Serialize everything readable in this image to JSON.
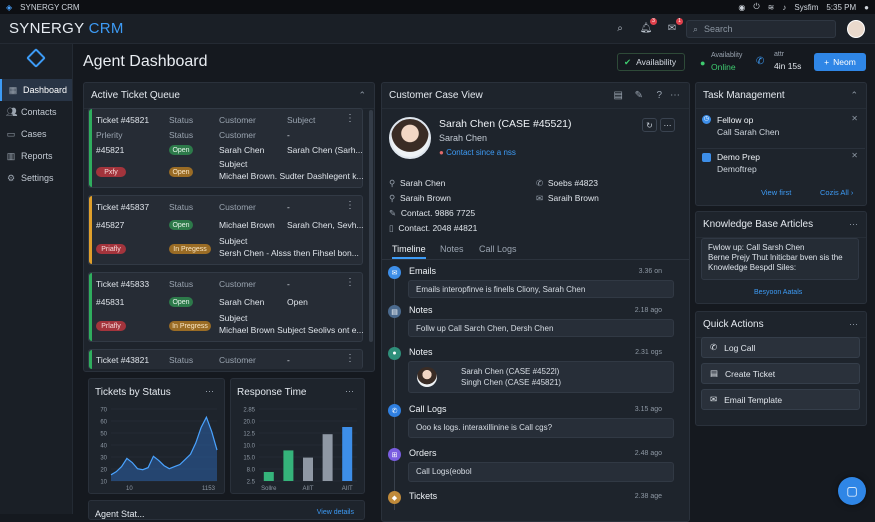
{
  "system_bar": {
    "app": "SYNERGY CRM",
    "user": "Sysfim",
    "time": "5:35 PM"
  },
  "header": {
    "brand_main": "SYNERGY",
    "brand_sub": "CRM",
    "search_placeholder": "Search",
    "notif_count": "3",
    "mail_count": "1"
  },
  "sidebar": {
    "items": [
      {
        "label": "Dashboard",
        "icon": "grid-icon"
      },
      {
        "label": "Contacts",
        "icon": "people-icon"
      },
      {
        "label": "Cases",
        "icon": "folder-icon"
      },
      {
        "label": "Reports",
        "icon": "chart-icon"
      },
      {
        "label": "Settings",
        "icon": "gear-icon"
      }
    ]
  },
  "page": {
    "title": "Agent Dashboard"
  },
  "status": {
    "availability": "Availability",
    "agent_label": "Availablity",
    "agent_status": "Online",
    "call_label": "attr",
    "call_time": "4in 15s",
    "new_button": "Neom"
  },
  "queue": {
    "title": "Active Ticket Queue",
    "tickets": [
      {
        "id": "Ticket #45821",
        "priority_label": "Prlerity",
        "num": "#45821",
        "status": "Status",
        "status_sub": "Status",
        "status_badge": "Open",
        "status2": "Open",
        "customer_hdr": "Customer",
        "customer_sub": "Customer",
        "customer": "Sarah Chen",
        "subject_hdr": "Subject",
        "subject_dash": "-",
        "subject": "Sarah Chen (Sarh...",
        "subj_label": "Subject",
        "subj_line": "Michael Brown. Sudter Dashlegent k...",
        "priority_badge": "Pxfy"
      },
      {
        "id": "Ticket #45837",
        "num": "#45827",
        "status": "Status",
        "status_badge": "Open",
        "status2": "In Pregess",
        "customer_hdr": "Customer",
        "customer": "Michael Brown",
        "subject_dash": "-",
        "subject": "Sarah Chen, Sevh...",
        "subj_label": "Subject",
        "subj_line": "Sersh Chen - Alsss then Fihsel bon...",
        "priority_badge": "Priafly"
      },
      {
        "id": "Ticket #45833",
        "num": "#45831",
        "status": "Status",
        "status_badge": "Open",
        "status2": "In Pregress",
        "customer_hdr": "Customer",
        "customer": "Sarah Chen",
        "subject_dash": "-",
        "subject": "Open",
        "subj_label": "Subject",
        "subj_line": "Michael Brown Subject Seolivs ont e...",
        "priority_badge": "Prlafly"
      },
      {
        "id": "Ticket #43821",
        "status": "Status",
        "customer_hdr": "Customer",
        "subject_dash": "-"
      }
    ]
  },
  "tickets_by_status": {
    "title": "Tickets by Status",
    "y_ticks": [
      "70",
      "60",
      "50",
      "40",
      "30",
      "20",
      "10"
    ],
    "x_ticks": [
      "10",
      "1153"
    ]
  },
  "response_time": {
    "title": "Response Time",
    "y_ticks": [
      "2.85",
      "20.0",
      "12.5",
      "10.0",
      "15.0",
      "8.0",
      "2.5"
    ],
    "x_ticks": [
      "Sollre",
      "AIIT",
      "AIIT"
    ]
  },
  "bottom_left": {
    "title": "Agent Stat...",
    "link": "View details"
  },
  "case": {
    "title": "Customer Case View",
    "name": "Sarah Chen (CASE #45521)",
    "subname": "Sarah Chen",
    "contact_link": "Contact since a nss",
    "info": [
      {
        "icon": "person-icon",
        "text": "Sarah Chen"
      },
      {
        "icon": "phone-icon",
        "text": "Soebs #4823"
      },
      {
        "icon": "person-icon",
        "text": "Saraih Brown"
      },
      {
        "icon": "mail-icon",
        "text": "Saraih Brown"
      },
      {
        "icon": "edit-icon",
        "text": "Contact. 9886 7725"
      },
      {
        "icon": "document-icon",
        "text": "Contact. 2048 #4821"
      }
    ],
    "tabs": [
      "Timeline",
      "Notes",
      "Call Logs"
    ],
    "timeline": [
      {
        "title": "Emails",
        "time": "3.36 on",
        "body": "Emails interopfinve is finells Cliony, Sarah Chen",
        "color": "#3d8ee8"
      },
      {
        "title": "Notes",
        "time": "2.18 ago",
        "body": "Follw up Call Sarch Chen, Dersh Chen",
        "color": "#4b6a8e"
      },
      {
        "title": "Notes",
        "time": "2.31 ogs",
        "body_l1": "Sarah Chen (CASE #4522l)",
        "body_l2": "Singh Chen (CASE #45821)",
        "color": "#2f8f7a"
      },
      {
        "title": "Call Logs",
        "time": "3.15 ago",
        "body": "Ooo ks logs. interaxillinine is Call cgs?",
        "color": "#2f7fe0"
      },
      {
        "title": "Orders",
        "time": "2.48 ago",
        "body": "Call Logs(eobol",
        "color": "#7a5de0"
      },
      {
        "title": "Tickets",
        "time": "2.38 age",
        "body": "",
        "color": "#c08a3a"
      }
    ]
  },
  "tasks": {
    "title": "Task Management",
    "items": [
      {
        "title": "Fellow op",
        "sub": "Call Sarah Chen"
      },
      {
        "title": "Demo Prep",
        "sub": "Demoftrep"
      }
    ],
    "view_first": "View first",
    "view_all": "Cozis All"
  },
  "kb": {
    "title": "Knowledge Base Articles",
    "line1": "Fwlow up: Call Sarsh Chen",
    "line2": "Berne Prejy Thut lniticbar bven sis the",
    "line3": "Knowledge Bespdl Siles:",
    "link": "Besyoon Aatals"
  },
  "quick_actions": {
    "title": "Quick Actions",
    "items": [
      {
        "label": "Log Call",
        "icon": "phone-icon"
      },
      {
        "label": "Create Ticket",
        "icon": "ticket-icon"
      },
      {
        "label": "Email Template",
        "icon": "mail-icon"
      }
    ]
  },
  "chart_data": [
    {
      "type": "area",
      "title": "Tickets by Status",
      "x_ticks": [
        "10",
        "1153"
      ],
      "ylim": [
        0,
        70
      ],
      "x": [
        0,
        1,
        2,
        3,
        4,
        5,
        6,
        7,
        8,
        9,
        10,
        11,
        12,
        13,
        14,
        15,
        16,
        17,
        18,
        19,
        20
      ],
      "values": [
        6,
        9,
        14,
        22,
        18,
        12,
        11,
        13,
        24,
        20,
        15,
        12,
        14,
        16,
        21,
        26,
        37,
        52,
        62,
        48,
        30
      ]
    },
    {
      "type": "bar",
      "title": "Response Time",
      "categories": [
        "Sollre",
        "",
        "AIIT",
        "",
        "AIIT"
      ],
      "ylim": [
        0,
        20
      ],
      "series": [
        {
          "values": [
            2.5,
            8.5,
            6.5,
            13,
            15
          ]
        }
      ]
    }
  ],
  "colors": {
    "accent": "#3d9bf5",
    "green": "#2e9e5e",
    "bg": "#15191f"
  }
}
